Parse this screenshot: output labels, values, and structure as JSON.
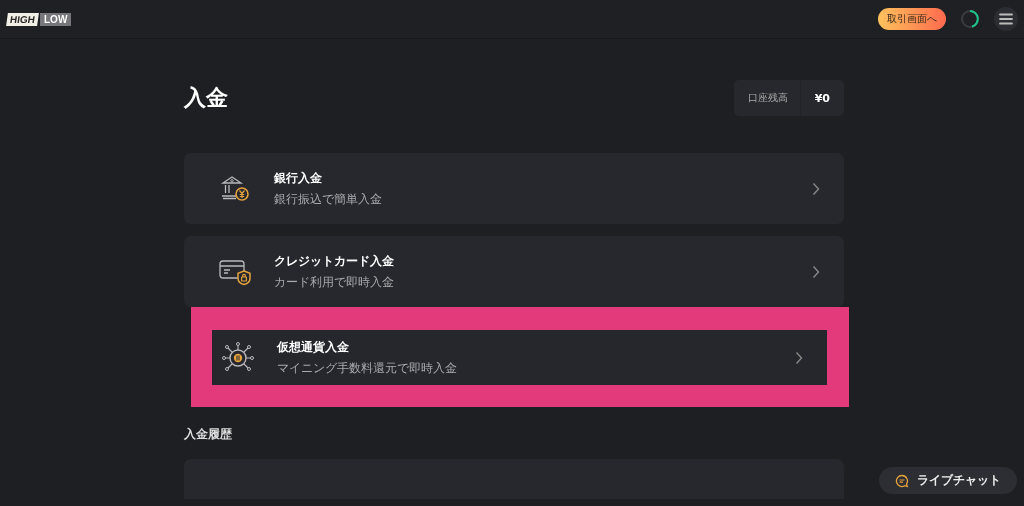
{
  "header": {
    "logo": [
      "HIGH",
      "LOW"
    ],
    "trade_button": "取引画面へ"
  },
  "page": {
    "title": "入金",
    "balance": {
      "label": "口座残高",
      "value": "¥0"
    }
  },
  "methods": [
    {
      "kind": "bank",
      "title": "銀行入金",
      "subtitle": "銀行振込で簡単入金",
      "highlighted": false
    },
    {
      "kind": "card",
      "title": "クレジットカード入金",
      "subtitle": "カード利用で即時入金",
      "highlighted": false
    },
    {
      "kind": "crypto",
      "title": "仮想通貨入金",
      "subtitle": "マイニング手数料還元で即時入金",
      "highlighted": true
    }
  ],
  "history": {
    "title": "入金履歴"
  },
  "live_chat": {
    "label": "ライブチャット"
  }
}
